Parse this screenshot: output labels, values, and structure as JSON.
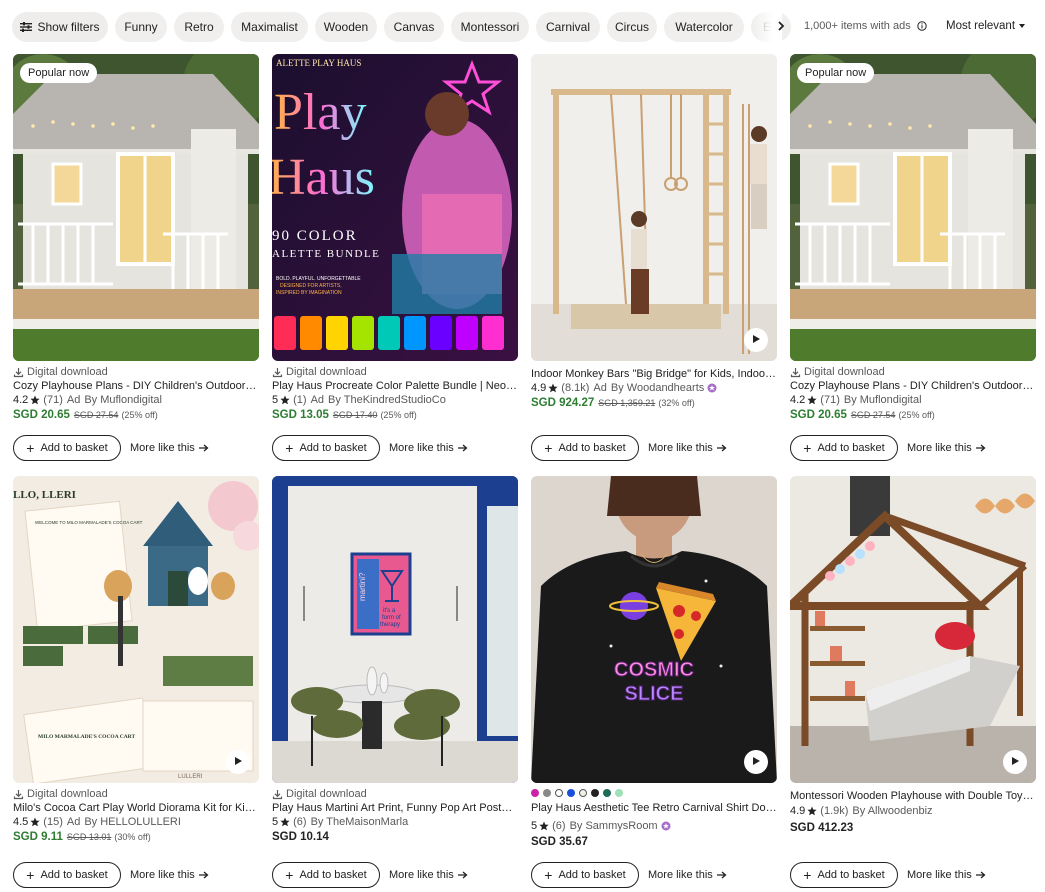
{
  "filters": {
    "show_filters": "Show filters",
    "chips": [
      "Funny",
      "Retro",
      "Maximalist",
      "Wooden",
      "Canvas",
      "Montessori",
      "Carnival",
      "Circus",
      "Watercolor",
      "E"
    ],
    "count": "1,000+ items with ads",
    "sort": "Most relevant"
  },
  "cards": [
    {
      "badge": "Popular now",
      "digital": "Digital download",
      "title": "Cozy Playhouse Plans - DIY Children's Outdoor Playhouse Plans",
      "rating": "4.2",
      "reviews": "(71)",
      "ad": "Ad",
      "by": "By Muflondigital",
      "price": "SGD 20.65",
      "was": "SGD 27.54",
      "off": "(25% off)",
      "basket": "Add to basket",
      "more": "More like this"
    },
    {
      "digital": "Digital download",
      "title": "Play Haus Procreate Color Palette Bundle | Neon Color Swatches",
      "rating": "5",
      "reviews": "(1)",
      "ad": "Ad",
      "by": "By TheKindredStudioCo",
      "price": "SGD 13.05",
      "was": "SGD 17.40",
      "off": "(25% off)",
      "basket": "Add to basket",
      "more": "More like this",
      "art": {
        "top": "ALETTE PLAY HAUS",
        "big1": "Play",
        "big2": "Haus",
        "line1": "90 COLOR",
        "line2": "ALETTE BUNDLE",
        "small1": "BOLD. PLAYFUL. UNFORGETTABLE",
        "small2": "DESIGNED FOR ARTISTS,",
        "small3": "INSPIRED BY IMAGINATION"
      }
    },
    {
      "title": "Indoor Monkey Bars \"Big Bridge\" for Kids, Indoor Climbing Wall",
      "rating": "4.9",
      "reviews": "(8.1k)",
      "ad": "Ad",
      "by": "By Woodandhearts",
      "price": "SGD 924.27",
      "was": "SGD 1,359.21",
      "off": "(32% off)",
      "basket": "Add to basket",
      "more": "More like this"
    },
    {
      "badge": "Popular now",
      "digital": "Digital download",
      "title": "Cozy Playhouse Plans - DIY Children's Outdoor Playhouse Plans",
      "rating": "4.2",
      "reviews": "(71)",
      "by": "By Muflondigital",
      "price": "SGD 20.65",
      "was": "SGD 27.54",
      "off": "(25% off)",
      "basket": "Add to basket",
      "more": "More like this"
    },
    {
      "digital": "Digital download",
      "title": "Milo's Cocoa Cart Play World Diorama Kit for Kids, Printable",
      "rating": "4.5",
      "reviews": "(15)",
      "ad": "Ad",
      "by": "By HELLOLULLERI",
      "price": "SGD 9.11",
      "was": "SGD 13.01",
      "off": "(30% off)",
      "basket": "Add to basket",
      "more": "More like this",
      "art": {
        "corner": "LLO, LLERI",
        "head": "WELCOME TO MILO MARMALADE'S COCOA CART",
        "foot": "MILO MARMALADE'S COCOA CART",
        "brand": "LULLERI"
      }
    },
    {
      "digital": "Digital download",
      "title": "Play Haus Martini Art Print, Funny Pop Art Poster, Cocktail Wall Art",
      "rating": "5",
      "reviews": "(6)",
      "by": "By TheMaisonMarla",
      "price": "SGD 10.14",
      "basket": "Add to basket",
      "more": "More like this",
      "art": {
        "poster1": "martini?",
        "poster2": "it's a",
        "poster3": "form of",
        "poster4": "therapy"
      }
    },
    {
      "title": "Play Haus Aesthetic Tee Retro Carnival Shirt Dopamine Decor",
      "rating": "5",
      "reviews": "(6)",
      "by": "By SammysRoom",
      "price": "SGD 35.67",
      "swatches": [
        "#cc22aa",
        "#888888",
        "#ffffff",
        "#1a4fd8",
        "#f2efe6",
        "#222222",
        "#1f6b5a",
        "#9fe0b6"
      ],
      "basket": "Add to basket",
      "more": "More like this",
      "art": {
        "shirt1": "COSMIC",
        "shirt2": "SLICE"
      }
    },
    {
      "title": "Montessori Wooden Playhouse with Double Toy Shelf and Bed",
      "rating": "4.9",
      "reviews": "(1.9k)",
      "by": "By Allwoodenbiz",
      "price": "SGD 412.23",
      "basket": "Add to basket",
      "more": "More like this"
    }
  ]
}
